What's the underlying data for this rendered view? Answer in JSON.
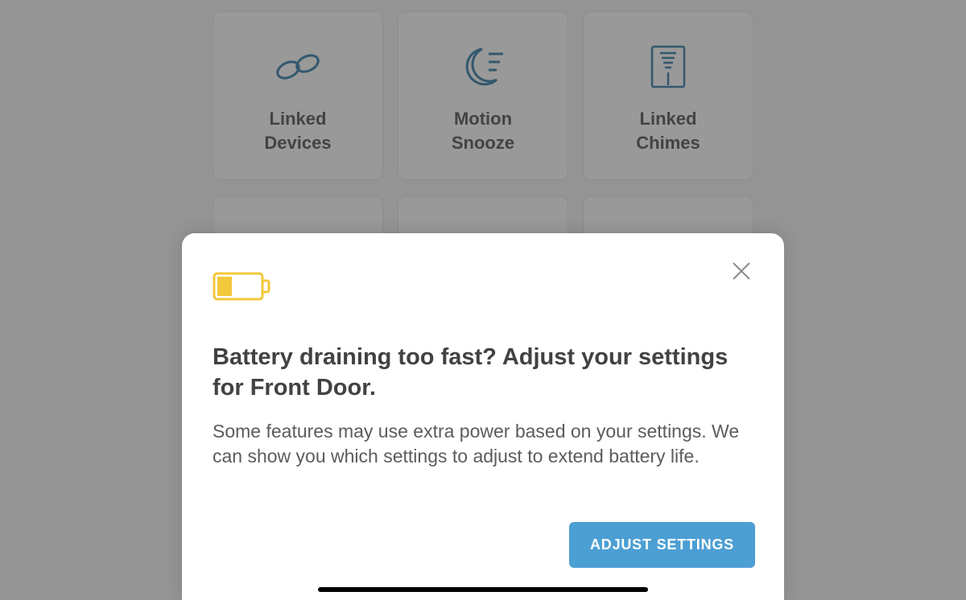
{
  "tiles": {
    "linked_devices": "Linked\nDevices",
    "motion_snooze": "Motion\nSnooze",
    "linked_chimes": "Linked\nChimes"
  },
  "sheet": {
    "title": "Battery draining too fast? Adjust your settings for Front Door.",
    "body": "Some features may use extra power based on your settings. We can show you which settings to adjust to extend battery life.",
    "cta": "ADJUST SETTINGS"
  }
}
